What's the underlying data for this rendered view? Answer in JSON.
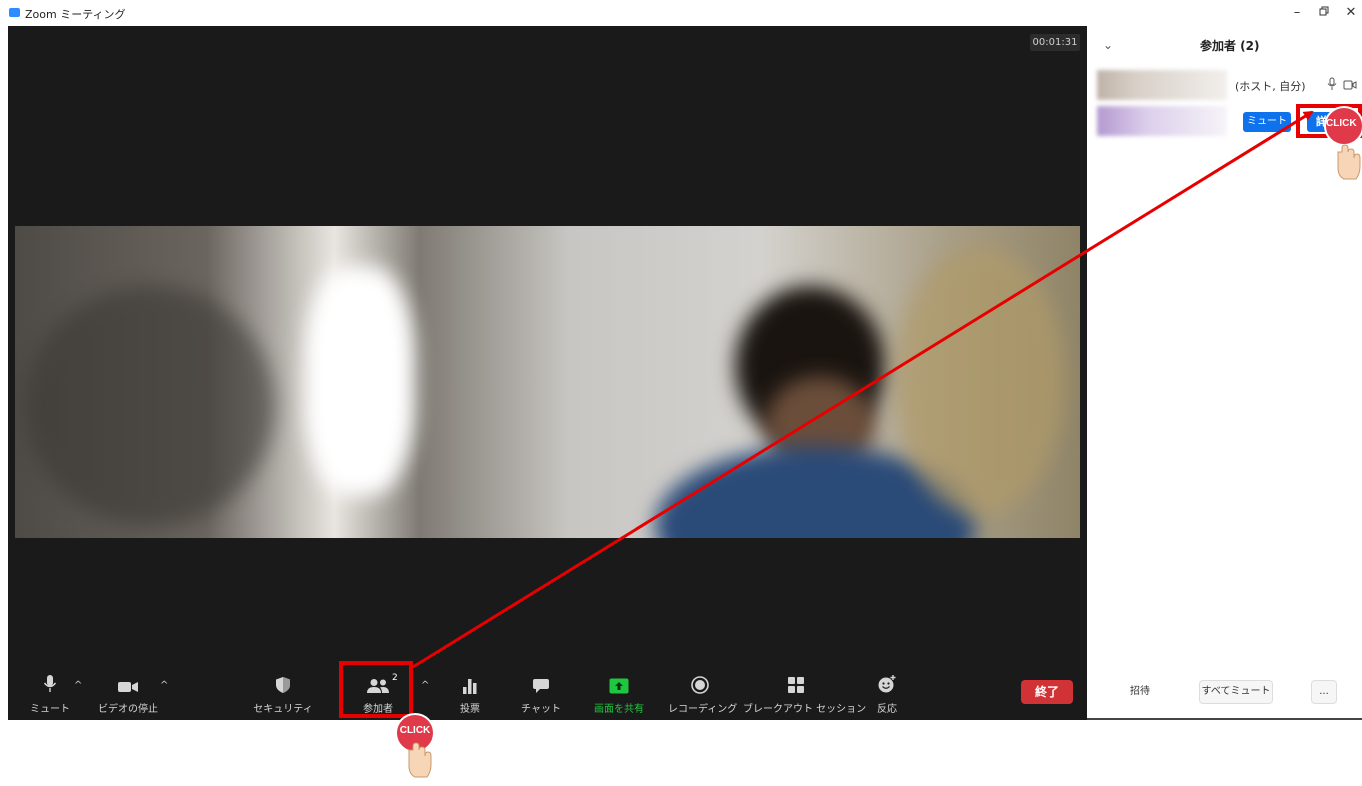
{
  "window": {
    "title": "Zoom ミーティング",
    "controls": [
      "–",
      "□",
      "✕"
    ]
  },
  "meeting": {
    "timer": "00:01:31"
  },
  "toolbar": {
    "mute_label": "ミュート",
    "video_label": "ビデオの停止",
    "security_label": "セキュリティ",
    "participants_label": "参加者",
    "participants_count": "2",
    "poll_label": "投票",
    "chat_label": "チャット",
    "share_label": "画面を共有",
    "record_label": "レコーディング",
    "breakout_label": "ブレークアウト セッション",
    "reactions_label": "反応",
    "end_label": "終了",
    "share_color": "#1fc63f",
    "end_color": "#d13236"
  },
  "participants_panel": {
    "title": "参加者 (2)",
    "participants": [
      {
        "role": "(ホスト, 自分)"
      },
      {
        "mute_label": "ミュート",
        "details_label": "詳細 ›"
      }
    ],
    "footer": {
      "invite_label": "招待",
      "mute_all_label": "すべてミュート",
      "more_label": "..."
    },
    "accent_color": "#0e72ed"
  },
  "annotations": {
    "click_label": "CLICK",
    "highlight_color": "#e60000"
  }
}
